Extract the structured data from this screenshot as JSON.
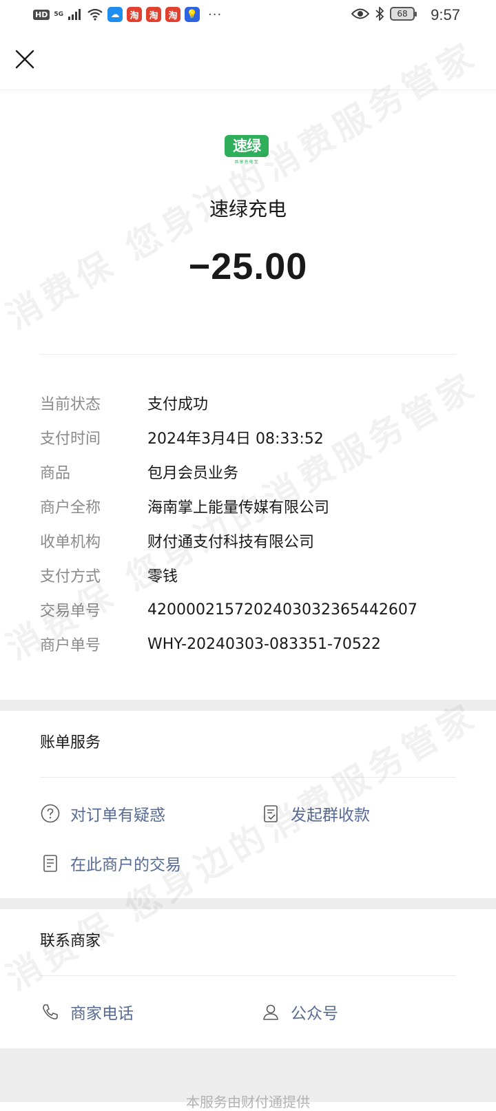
{
  "status_bar": {
    "hd": "HD",
    "network": "5G",
    "time": "9:57",
    "battery": "68",
    "app_chips": [
      "淘",
      "淘",
      "淘"
    ],
    "more": "···"
  },
  "header": {
    "logo_text": "速绿",
    "logo_sub": "共享充电宝",
    "merchant_name": "速绿充电",
    "amount": "−25.00"
  },
  "details": {
    "rows": [
      {
        "label": "当前状态",
        "value": "支付成功"
      },
      {
        "label": "支付时间",
        "value": "2024年3月4日 08:33:52"
      },
      {
        "label": "商品",
        "value": "包月会员业务"
      },
      {
        "label": "商户全称",
        "value": "海南掌上能量传媒有限公司"
      },
      {
        "label": "收单机构",
        "value": "财付通支付科技有限公司"
      },
      {
        "label": "支付方式",
        "value": "零钱"
      },
      {
        "label": "交易单号",
        "value": "4200002157202403032365442607"
      },
      {
        "label": "商户单号",
        "value": "WHY-20240303-083351-70522"
      }
    ]
  },
  "bill_service": {
    "title": "账单服务",
    "items": [
      {
        "label": "对订单有疑惑",
        "icon": "question-icon"
      },
      {
        "label": "发起群收款",
        "icon": "group-receipt-icon"
      },
      {
        "label": "在此商户的交易",
        "icon": "document-icon"
      }
    ]
  },
  "contact": {
    "title": "联系商家",
    "items": [
      {
        "label": "商家电话",
        "icon": "phone-icon"
      },
      {
        "label": "公众号",
        "icon": "person-icon"
      }
    ]
  },
  "footer": {
    "text": "本服务由财付通提供"
  },
  "watermark": {
    "text": "消费保 您身边的消费服务管家"
  },
  "colors": {
    "link": "#576b95",
    "logo": "#2faf5c",
    "band": "#ededed"
  }
}
